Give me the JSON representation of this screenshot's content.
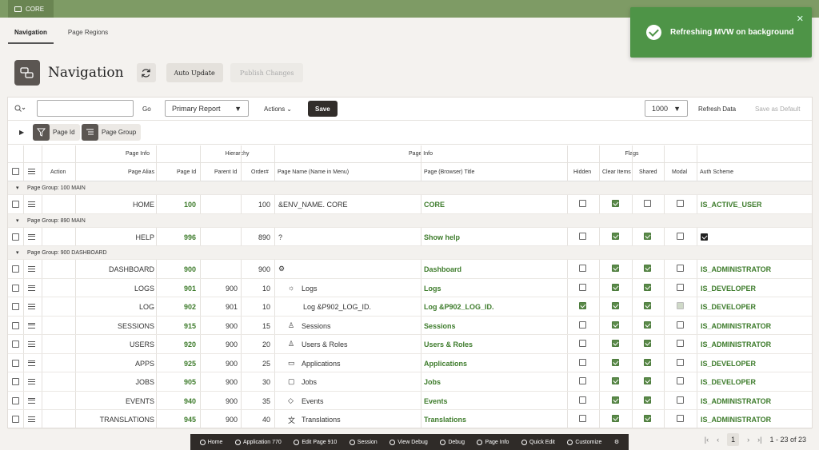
{
  "app": {
    "name": "CORE"
  },
  "tabs": [
    "Navigation",
    "Page Regions"
  ],
  "page": {
    "title": "Navigation",
    "auto_update": "Auto Update",
    "publish": "Publish Changes"
  },
  "toolbar": {
    "go": "Go",
    "report": "Primary Report",
    "actions": "Actions",
    "save": "Save",
    "rows": "1000",
    "refresh": "Refresh Data",
    "save_default": "Save as Default"
  },
  "filters": [
    "Page Id",
    "Page Group"
  ],
  "groups": {
    "page_info": "Page Info",
    "hierarchy": "Hierarchy",
    "page_info2": "Page Info",
    "flags": "Flags"
  },
  "columns": {
    "action": "Action",
    "alias": "Page Alias",
    "id": "Page Id",
    "parent": "Parent Id",
    "order": "Order#",
    "name": "Page Name (Name in Menu)",
    "title": "Page (Browser) Title",
    "hidden": "Hidden",
    "clear": "Clear Items",
    "shared": "Shared",
    "modal": "Modal",
    "auth": "Auth Scheme"
  },
  "rows": [
    {
      "group": "Page Group: 100 MAIN"
    },
    {
      "alias": "HOME",
      "id": "100",
      "parent": "",
      "order": "100",
      "name": "&ENV_NAME. CORE",
      "title": "CORE",
      "hidden": 0,
      "clear": 1,
      "shared": 0,
      "modal": 0,
      "auth": "IS_ACTIVE_USER"
    },
    {
      "group": "Page Group: 890 MAIN"
    },
    {
      "alias": "HELP",
      "id": "996",
      "parent": "",
      "order": "890",
      "name": "?",
      "title": "Show help",
      "hidden": 0,
      "clear": 1,
      "shared": 1,
      "modal": 0,
      "auth": ""
    },
    {
      "group": "Page Group: 900 DASHBOARD"
    },
    {
      "alias": "DASHBOARD",
      "id": "900",
      "parent": "",
      "order": "900",
      "name": "",
      "title": "Dashboard",
      "hidden": 0,
      "clear": 1,
      "shared": 1,
      "modal": 0,
      "auth": "IS_ADMINISTRATOR"
    },
    {
      "alias": "LOGS",
      "id": "901",
      "parent": "900",
      "order": "10",
      "name": "Logs",
      "title": "Logs",
      "hidden": 0,
      "clear": 1,
      "shared": 1,
      "modal": 0,
      "auth": "IS_DEVELOPER"
    },
    {
      "alias": "LOG",
      "id": "902",
      "parent": "901",
      "order": "10",
      "name": "Log &P902_LOG_ID.",
      "title": "Log &P902_LOG_ID.",
      "hidden": 1,
      "clear": 1,
      "shared": 1,
      "modal": 2,
      "auth": "IS_DEVELOPER"
    },
    {
      "alias": "SESSIONS",
      "id": "915",
      "parent": "900",
      "order": "15",
      "name": "Sessions",
      "title": "Sessions",
      "hidden": 0,
      "clear": 1,
      "shared": 1,
      "modal": 0,
      "auth": "IS_ADMINISTRATOR"
    },
    {
      "alias": "USERS",
      "id": "920",
      "parent": "900",
      "order": "20",
      "name": "Users & Roles",
      "title": "Users & Roles",
      "hidden": 0,
      "clear": 1,
      "shared": 1,
      "modal": 0,
      "auth": "IS_ADMINISTRATOR"
    },
    {
      "alias": "APPS",
      "id": "925",
      "parent": "900",
      "order": "25",
      "name": "Applications",
      "title": "Applications",
      "hidden": 0,
      "clear": 1,
      "shared": 1,
      "modal": 0,
      "auth": "IS_DEVELOPER"
    },
    {
      "alias": "JOBS",
      "id": "905",
      "parent": "900",
      "order": "30",
      "name": "Jobs",
      "title": "Jobs",
      "hidden": 0,
      "clear": 1,
      "shared": 1,
      "modal": 0,
      "auth": "IS_DEVELOPER"
    },
    {
      "alias": "EVENTS",
      "id": "940",
      "parent": "900",
      "order": "35",
      "name": "Events",
      "title": "Events",
      "hidden": 0,
      "clear": 1,
      "shared": 1,
      "modal": 0,
      "auth": "IS_ADMINISTRATOR"
    },
    {
      "alias": "TRANSLATIONS",
      "id": "945",
      "parent": "900",
      "order": "40",
      "name": "Translations",
      "title": "Translations",
      "hidden": 0,
      "clear": 1,
      "shared": 1,
      "modal": 0,
      "auth": "IS_ADMINISTRATOR"
    }
  ],
  "devbar": [
    "Home",
    "Application 770",
    "Edit Page 910",
    "Session",
    "View Debug",
    "Debug",
    "Page Info",
    "Quick Edit",
    "Customize"
  ],
  "pager": {
    "page": "1",
    "range": "1 - 23 of 23"
  },
  "toast": {
    "message": "Refreshing MVW on background"
  }
}
